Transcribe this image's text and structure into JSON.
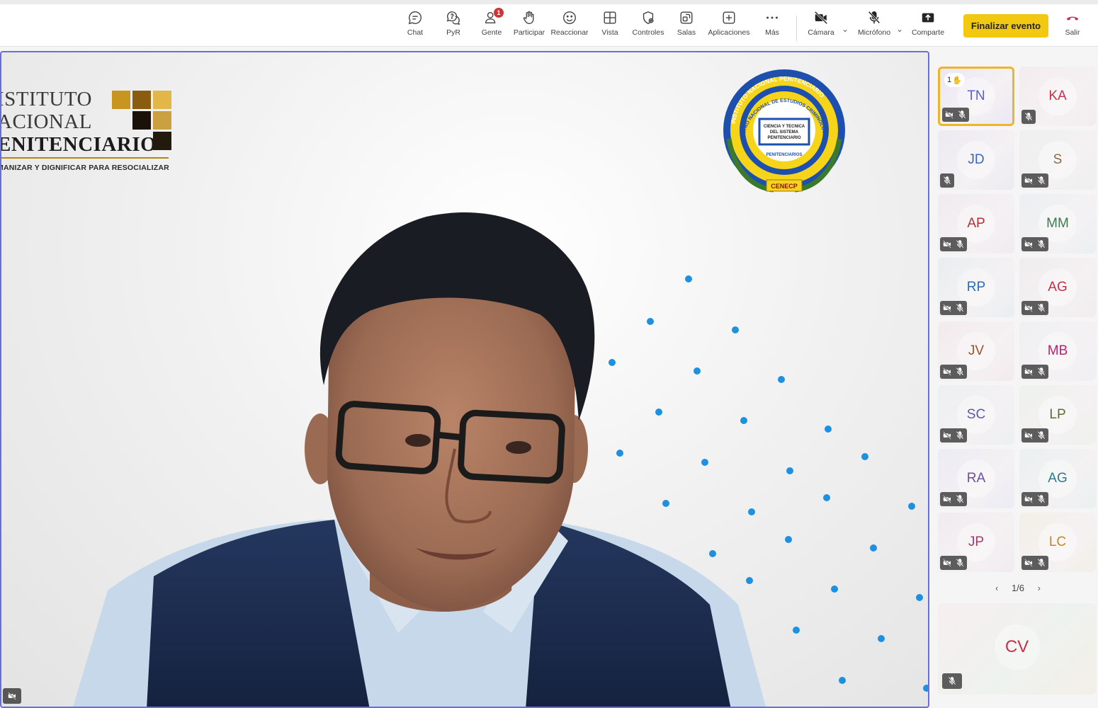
{
  "toolbar": {
    "items": [
      {
        "label": "Chat",
        "icon": "chat-icon"
      },
      {
        "label": "PyR",
        "icon": "qa-icon"
      },
      {
        "label": "Gente",
        "icon": "people-icon",
        "badge": "1"
      },
      {
        "label": "Participar",
        "icon": "hand-icon"
      },
      {
        "label": "Reaccionar",
        "icon": "smiley-icon"
      },
      {
        "label": "Vista",
        "icon": "grid-icon"
      },
      {
        "label": "Controles",
        "icon": "shield-gear-icon"
      },
      {
        "label": "Salas",
        "icon": "rooms-icon"
      },
      {
        "label": "Aplicaciones",
        "icon": "plus-box-icon"
      },
      {
        "label": "Más",
        "icon": "more-icon"
      },
      {
        "label": "Cámara",
        "icon": "camera-off-icon"
      },
      {
        "label": "Micrófono",
        "icon": "mic-off-icon"
      },
      {
        "label": "Comparte",
        "icon": "share-icon"
      }
    ],
    "end_event": "Finalizar evento",
    "leave": "Salir"
  },
  "stage": {
    "logo_lines": [
      "ISTITUTO",
      "ACIONAL",
      "ENITENCIARIO"
    ],
    "motto": "MANIZAR Y DIGNIFICAR PARA RESOCIALIZAR",
    "seal": {
      "outer": "INSTITUTO NACIONAL PENITENCIARIO",
      "inner": "CENTRO NACIONAL DE ESTUDIOS CRIMINOLÓGICOS",
      "book": [
        "CIENCIA Y TECNICA",
        "DEL SISTEMA",
        "PENITENCIARIO"
      ],
      "bottom": "PENITENCIARIOS",
      "ribbon": "CENECP"
    }
  },
  "participants": [
    {
      "initials": "TN",
      "color": "#5b5fc7",
      "bg": "#ece7f5",
      "active": true,
      "raised_hand": "1",
      "cam_off": true
    },
    {
      "initials": "KA",
      "color": "#c4314b",
      "bg": "#f3ecee",
      "cam_off": false
    },
    {
      "initials": "JD",
      "color": "#3a66b5",
      "bg": "#eceaf2",
      "cam_off": false
    },
    {
      "initials": "S",
      "color": "#8a6a4a",
      "bg": "#eef0ee",
      "cam_off": true
    },
    {
      "initials": "AP",
      "color": "#b0303a",
      "bg": "#f1ebf0",
      "cam_off": true
    },
    {
      "initials": "MM",
      "color": "#3d7b4f",
      "bg": "#ebf0f2",
      "cam_off": true
    },
    {
      "initials": "RP",
      "color": "#2e6ab1",
      "bg": "#e9eef0",
      "cam_off": true
    },
    {
      "initials": "AG",
      "color": "#c4314b",
      "bg": "#f0edee",
      "cam_off": true
    },
    {
      "initials": "JV",
      "color": "#a0522d",
      "bg": "#f3ebee",
      "cam_off": true
    },
    {
      "initials": "MB",
      "color": "#b4236f",
      "bg": "#eff0f3",
      "cam_off": true
    },
    {
      "initials": "SC",
      "color": "#5a5aa8",
      "bg": "#eceff1",
      "cam_off": true
    },
    {
      "initials": "LP",
      "color": "#5d6b3a",
      "bg": "#eef1ec",
      "cam_off": true
    },
    {
      "initials": "RA",
      "color": "#6b4fa0",
      "bg": "#ecebf4",
      "cam_off": true
    },
    {
      "initials": "AG",
      "color": "#2b7a8a",
      "bg": "#e9f1ef",
      "cam_off": true
    },
    {
      "initials": "JP",
      "color": "#a83a6a",
      "bg": "#f1ebef",
      "cam_off": true
    },
    {
      "initials": "LC",
      "color": "#c08a1e",
      "bg": "#f2f0e6",
      "cam_off": true
    }
  ],
  "pager": {
    "label": "1/6"
  },
  "spotlight_tile": {
    "initials": "CV"
  }
}
